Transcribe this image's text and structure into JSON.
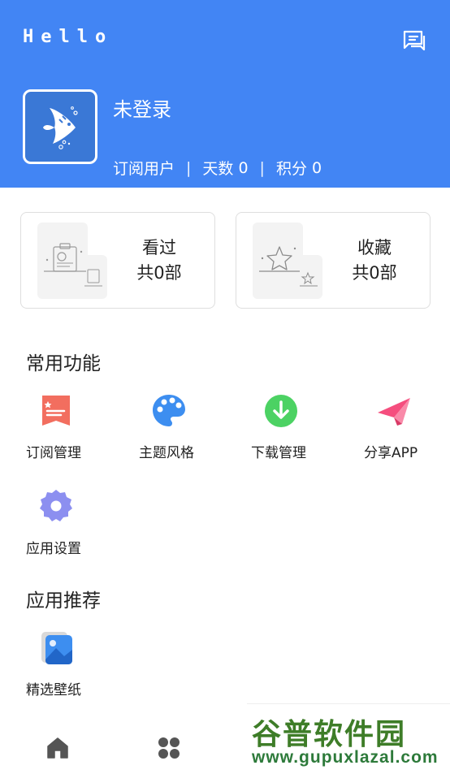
{
  "header": {
    "title": "Hello",
    "username": "未登录",
    "user_type": "订阅用户",
    "days_label": "天数",
    "days_value": "0",
    "points_label": "积分",
    "points_value": "0",
    "separator": "|",
    "accent": "#4285f4"
  },
  "cards": {
    "watched": {
      "title": "看过",
      "count": "共0部"
    },
    "favorites": {
      "title": "收藏",
      "count": "共0部"
    }
  },
  "sections": {
    "common_title": "常用功能",
    "recommend_title": "应用推荐"
  },
  "functions": [
    {
      "label": "订阅管理",
      "icon": "subscription-icon",
      "color": "#f26e5f"
    },
    {
      "label": "主题风格",
      "icon": "palette-icon",
      "color": "#3d8ef0"
    },
    {
      "label": "下载管理",
      "icon": "download-icon",
      "color": "#4cd263"
    },
    {
      "label": "分享APP",
      "icon": "paper-plane-icon",
      "color": "#f54e7e"
    },
    {
      "label": "应用设置",
      "icon": "gear-icon",
      "color": "#8c8ff0"
    }
  ],
  "recommend": [
    {
      "label": "精选壁纸",
      "icon": "wallpaper-icon",
      "color": "#3d8ef0"
    }
  ],
  "bottom_nav": [
    {
      "icon": "home-icon"
    },
    {
      "icon": "grid-icon"
    }
  ],
  "watermark": {
    "brand": "谷普软件园",
    "url": "www.gupuxlazal.com"
  }
}
